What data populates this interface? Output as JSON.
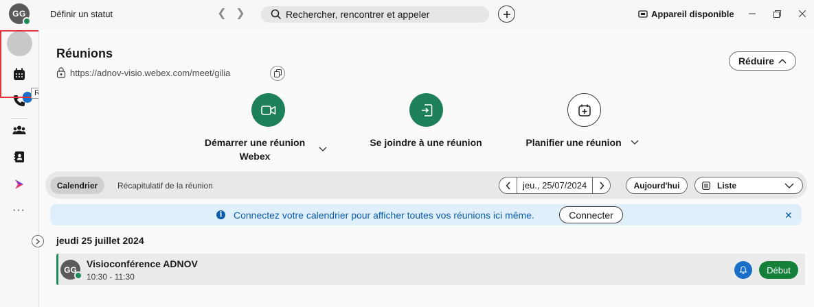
{
  "topbar": {
    "avatar_initials": "GG",
    "status_label": "Définir un statut",
    "search_placeholder": "Rechercher, rencontrer et appeler",
    "device_label": "Appareil disponible"
  },
  "sidebar": {
    "active_tooltip": "Réunions",
    "items": [
      {
        "icon": "chat-bubble-icon"
      },
      {
        "icon": "calendar-icon",
        "active": true
      },
      {
        "icon": "phone-icon"
      },
      {
        "icon": "people-icon"
      },
      {
        "icon": "contacts-icon"
      },
      {
        "icon": "vidcast-icon"
      },
      {
        "icon": "more-icon"
      }
    ],
    "more_label": "···"
  },
  "meetings": {
    "title": "Réunions",
    "personal_url": "https://adnov-visio.webex.com/meet/gilia",
    "reduce_label": "Réduire",
    "actions": [
      {
        "label": "Démarrer une réunion Webex",
        "icon": "video-camera-icon"
      },
      {
        "label": "Se joindre à une réunion",
        "icon": "join-door-icon"
      },
      {
        "label": "Planifier une réunion",
        "icon": "calendar-add-icon"
      }
    ]
  },
  "tabs": {
    "calendar": "Calendrier",
    "recap": "Récapitulatif de la réunion"
  },
  "date_nav": {
    "current_date": "jeu., 25/07/2024",
    "today_label": "Aujourd'hui",
    "view_label": "Liste"
  },
  "banner": {
    "text": "Connectez votre calendrier pour afficher toutes vos réunions ici même.",
    "button": "Connecter",
    "close": "✕"
  },
  "schedule": {
    "day_heading": "jeudi 25 juillet 2024",
    "entries": [
      {
        "avatar_initials": "GG",
        "title": "Visioconférence ADNOV",
        "time": "10:30 - 11:30",
        "start_label": "Début"
      }
    ]
  },
  "colors": {
    "accent_green": "#1e8058",
    "start_green": "#14803a",
    "banner_bg": "#dff0fb",
    "banner_text": "#0b5cad",
    "highlight_red": "#e4343b"
  }
}
